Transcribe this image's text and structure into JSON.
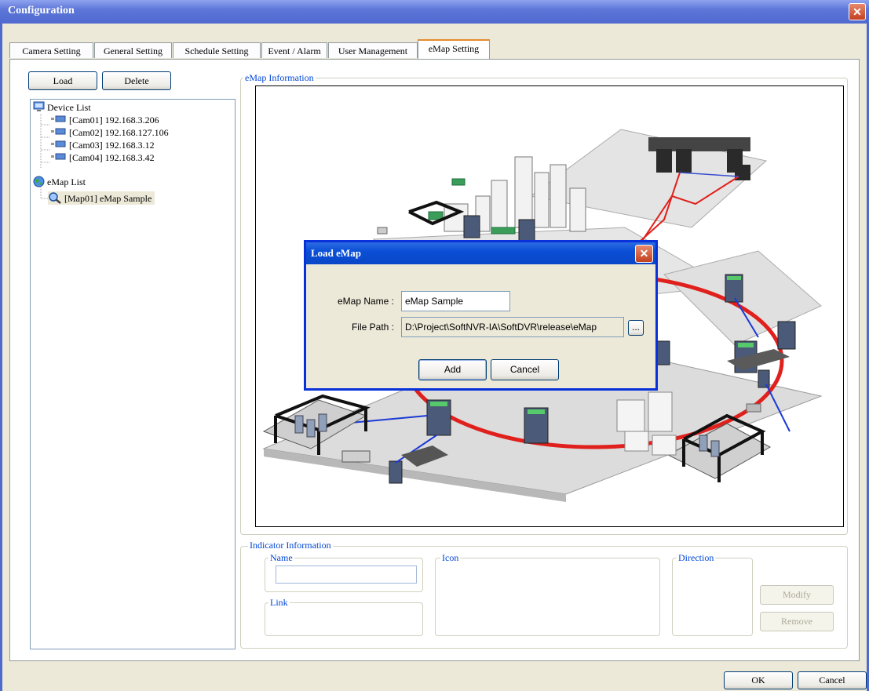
{
  "window": {
    "title": "Configuration",
    "close_glyph": "✕"
  },
  "tabs": [
    {
      "label": "Camera Setting"
    },
    {
      "label": "General Setting"
    },
    {
      "label": "Schedule Setting"
    },
    {
      "label": "Event / Alarm"
    },
    {
      "label": "User Management"
    },
    {
      "label": "eMap Setting"
    }
  ],
  "active_tab": "eMap Setting",
  "left_panel": {
    "load_label": "Load",
    "delete_label": "Delete",
    "tree": {
      "device_list": "Device List",
      "devices": [
        "[Cam01] 192.168.3.206",
        "[Cam02] 192.168.127.106",
        "[Cam03] 192.168.3.12",
        "[Cam04] 192.168.3.42"
      ],
      "emap_list": "eMap List",
      "maps": [
        "[Map01] eMap Sample"
      ]
    }
  },
  "emap_info": {
    "label": "eMap Information"
  },
  "indicator": {
    "label": "Indicator  Information",
    "name_label": "Name",
    "name_value": "",
    "icon_label": "Icon",
    "direction_label": "Direction",
    "link_label": "Link",
    "modify_label": "Modify",
    "remove_label": "Remove"
  },
  "footer": {
    "ok_label": "OK",
    "cancel_label": "Cancel"
  },
  "dialog": {
    "title": "Load eMap",
    "name_label": "eMap Name :",
    "name_value": "eMap Sample",
    "path_label": "File Path :",
    "path_value": "D:\\Project\\SoftNVR-IA\\SoftDVR\\release\\eMap",
    "browse_label": "...",
    "add_label": "Add",
    "cancel_label": "Cancel"
  },
  "colors": {
    "titlebar": "#4f69cf",
    "dialog_titlebar": "#0a4fd6",
    "group_label": "#0046d5",
    "ring": "#e0201c"
  }
}
